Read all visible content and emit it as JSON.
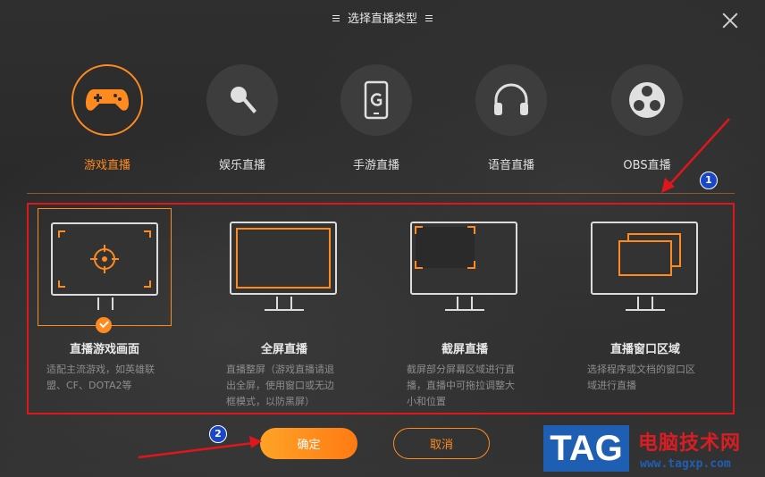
{
  "dialog": {
    "title": "选择直播类型"
  },
  "live_types": [
    {
      "label": "游戏直播",
      "icon": "gamepad-icon",
      "active": true
    },
    {
      "label": "娱乐直播",
      "icon": "microphone-icon",
      "active": false
    },
    {
      "label": "手游直播",
      "icon": "mobile-g-icon",
      "active": false
    },
    {
      "label": "语音直播",
      "icon": "headphones-icon",
      "active": false
    },
    {
      "label": "OBS直播",
      "icon": "obs-icon",
      "active": false
    }
  ],
  "capture_modes": [
    {
      "title": "直播游戏画面",
      "desc": "适配主流游戏，如英雄联盟、CF、DOTA2等",
      "selected": true
    },
    {
      "title": "全屏直播",
      "desc": "直播整屏（游戏直播请退出全屏，使用窗口或无边框模式，以防黑屏）",
      "selected": false
    },
    {
      "title": "截屏直播",
      "desc": "截屏部分屏幕区域进行直播，直播中可拖拉调整大小和位置",
      "selected": false
    },
    {
      "title": "直播窗口区域",
      "desc": "选择程序或文档的窗口区域进行直播",
      "selected": false
    }
  ],
  "buttons": {
    "ok": "确定",
    "cancel": "取消"
  },
  "markers": [
    "1",
    "2"
  ],
  "watermark": {
    "logo": "TAG",
    "site_name": "电脑技术网",
    "url": "www.tagxp.com"
  },
  "colors": {
    "accent": "#ff8a1f",
    "highlight": "#e0161d",
    "marker": "#1a46c9"
  }
}
